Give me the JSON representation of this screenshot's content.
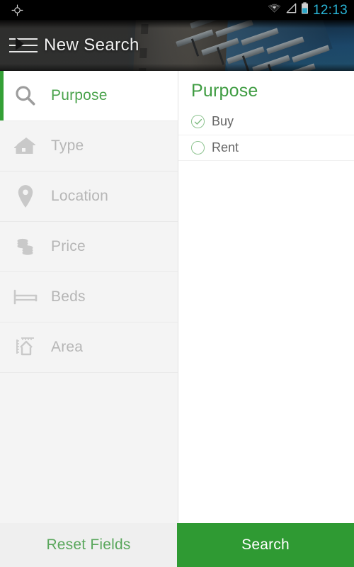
{
  "status_bar": {
    "left_icon": "gps-crosshair-icon",
    "icons": [
      "wifi-icon",
      "cellular-signal-icon",
      "battery-icon"
    ],
    "time": "12:13",
    "time_color": "#29b6d8",
    "background": "#000000"
  },
  "header": {
    "menu_icon": "hamburger-menu-icon",
    "title": "New Search",
    "background_image": "modern-building-glass-facade-photo"
  },
  "theme": {
    "accent_green": "#2f9a33",
    "accent_green_text": "#4aa34c",
    "muted_gray": "#b6b6b6",
    "panel_bg": "#ffffff",
    "sidebar_bg": "#f4f4f4"
  },
  "sidebar": {
    "items": [
      {
        "label": "Purpose",
        "icon": "magnifier-icon",
        "active": true
      },
      {
        "label": "Type",
        "icon": "house-icon",
        "active": false
      },
      {
        "label": "Location",
        "icon": "map-pin-icon",
        "active": false
      },
      {
        "label": "Price",
        "icon": "coins-stack-icon",
        "active": false
      },
      {
        "label": "Beds",
        "icon": "bed-icon",
        "active": false
      },
      {
        "label": "Area",
        "icon": "house-ruler-icon",
        "active": false
      }
    ]
  },
  "panel": {
    "title": "Purpose",
    "options": [
      {
        "label": "Buy",
        "selected": true,
        "icon": "radio-checked-icon"
      },
      {
        "label": "Rent",
        "selected": false,
        "icon": "radio-unchecked-icon"
      }
    ]
  },
  "bottom_bar": {
    "reset_label": "Reset Fields",
    "search_label": "Search"
  }
}
